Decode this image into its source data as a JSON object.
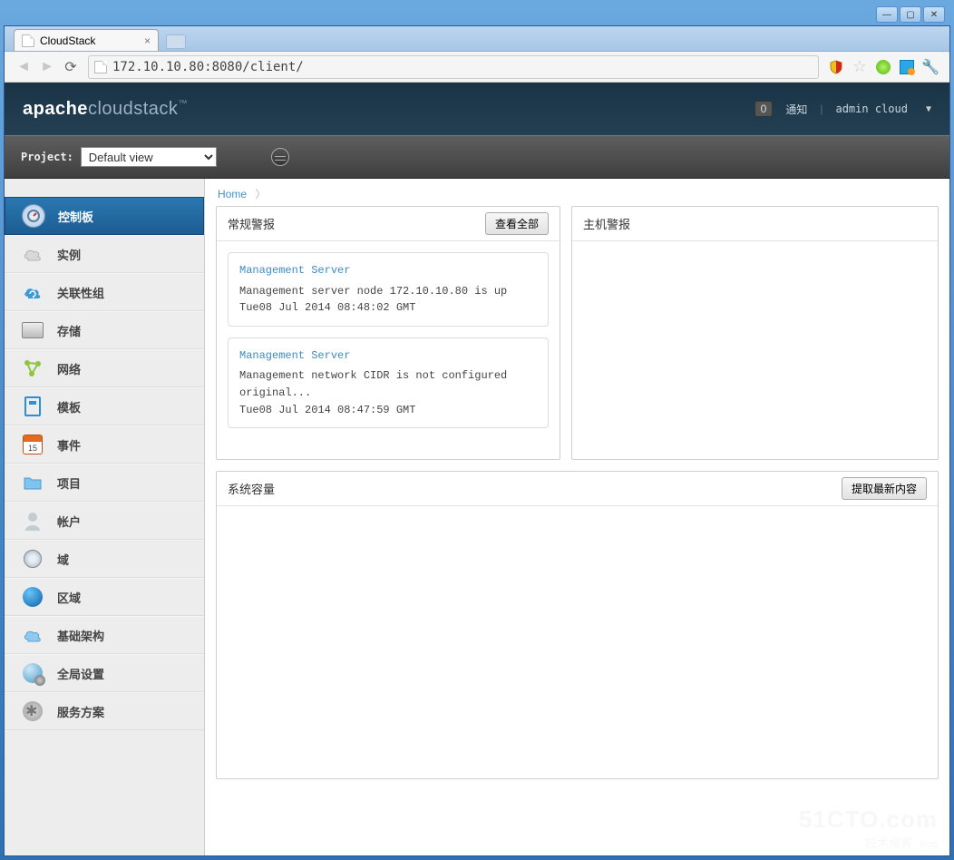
{
  "window": {
    "tab_title": "CloudStack"
  },
  "browser": {
    "url": "172.10.10.80:8080/client/"
  },
  "header": {
    "logo_bold": "apache",
    "logo_rest": "cloudstack",
    "notif_count": "0",
    "notif_label": "通知",
    "user": "admin cloud"
  },
  "subbar": {
    "project_label": "Project:",
    "project_value": "Default view"
  },
  "sidebar": {
    "items": [
      {
        "label": "控制板",
        "icon": "dash",
        "active": true
      },
      {
        "label": "实例",
        "icon": "cloud"
      },
      {
        "label": "关联性组",
        "icon": "cloud-sync"
      },
      {
        "label": "存储",
        "icon": "storage"
      },
      {
        "label": "网络",
        "icon": "network"
      },
      {
        "label": "模板",
        "icon": "template"
      },
      {
        "label": "事件",
        "icon": "event",
        "badge": "15"
      },
      {
        "label": "项目",
        "icon": "folder"
      },
      {
        "label": "帐户",
        "icon": "user"
      },
      {
        "label": "域",
        "icon": "domain"
      },
      {
        "label": "区域",
        "icon": "zone"
      },
      {
        "label": "基础架构",
        "icon": "infra"
      },
      {
        "label": "全局设置",
        "icon": "global"
      },
      {
        "label": "服务方案",
        "icon": "service"
      }
    ]
  },
  "breadcrumb": {
    "home": "Home"
  },
  "panels": {
    "general_alerts": {
      "title": "常规警报",
      "view_all": "查看全部",
      "items": [
        {
          "title": "Management Server",
          "msg": "Management server node 172.10.10.80 is up",
          "timestamp": "Tue08 Jul 2014 08:48:02 GMT"
        },
        {
          "title": "Management Server",
          "msg": "Management network CIDR is not configured original...",
          "timestamp": "Tue08 Jul 2014 08:47:59 GMT"
        }
      ]
    },
    "host_alerts": {
      "title": "主机警报"
    },
    "capacity": {
      "title": "系统容量",
      "refresh_btn": "提取最新内容"
    }
  },
  "watermark": {
    "line1": "51CTO.com",
    "line2": "技术博客",
    "line2_en": "Blog"
  }
}
